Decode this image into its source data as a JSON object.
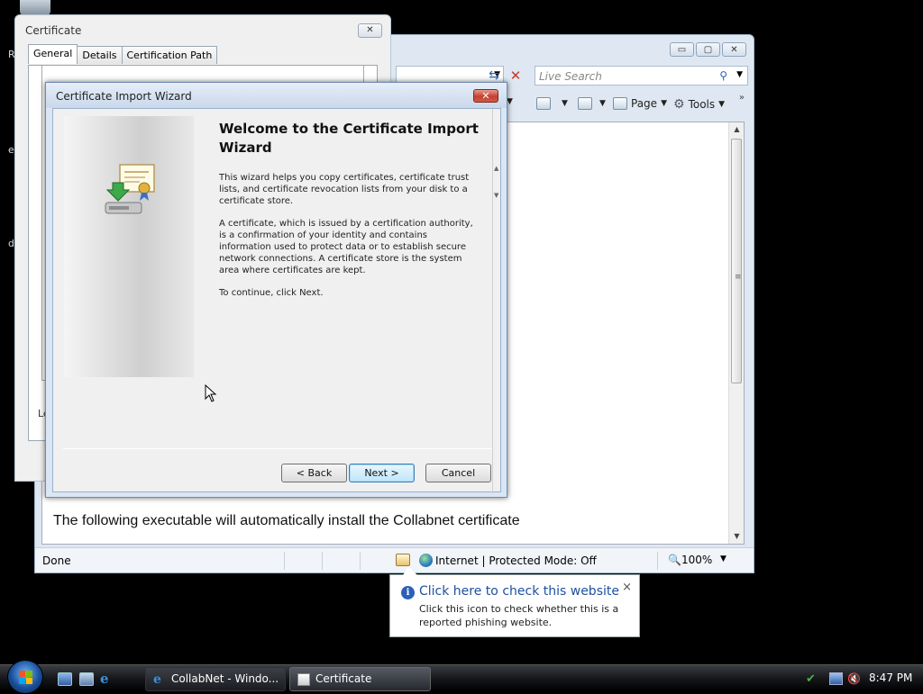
{
  "desktop": {
    "fragments": [
      "R",
      "e",
      "d"
    ]
  },
  "ie": {
    "search_placeholder": "Live Search",
    "cmd_page": "Page",
    "cmd_tools": "Tools",
    "content_text": "The following executable will automatically install the Collabnet certificate",
    "status": "Done",
    "zone": "Internet | Protected Mode: Off",
    "zoom": "100%"
  },
  "cert_window": {
    "title": "Certificate",
    "tabs": [
      "General",
      "Details",
      "Certification Path"
    ],
    "fragment": "Le"
  },
  "wizard": {
    "title": "Certificate Import Wizard",
    "heading": "Welcome to the Certificate Import Wizard",
    "p1": "This wizard helps you copy certificates, certificate trust lists, and certificate revocation lists from your disk to a certificate store.",
    "p2": "A certificate, which is issued by a certification authority, is a confirmation of your identity and contains information used to protect data or to establish secure network connections. A certificate store is the system area where certificates are kept.",
    "p3": "To continue, click Next.",
    "back": "< Back",
    "next": "Next >",
    "cancel": "Cancel"
  },
  "balloon": {
    "title": "Click here to check this website",
    "text": "Click this icon to check whether this is a reported phishing website.",
    "close": "×"
  },
  "taskbar": {
    "tasks": [
      "CollabNet - Windo...",
      "Certificate"
    ],
    "clock": "8:47 PM"
  },
  "colors": {
    "accent": "#1e50a2",
    "close_red": "#c4412f"
  }
}
